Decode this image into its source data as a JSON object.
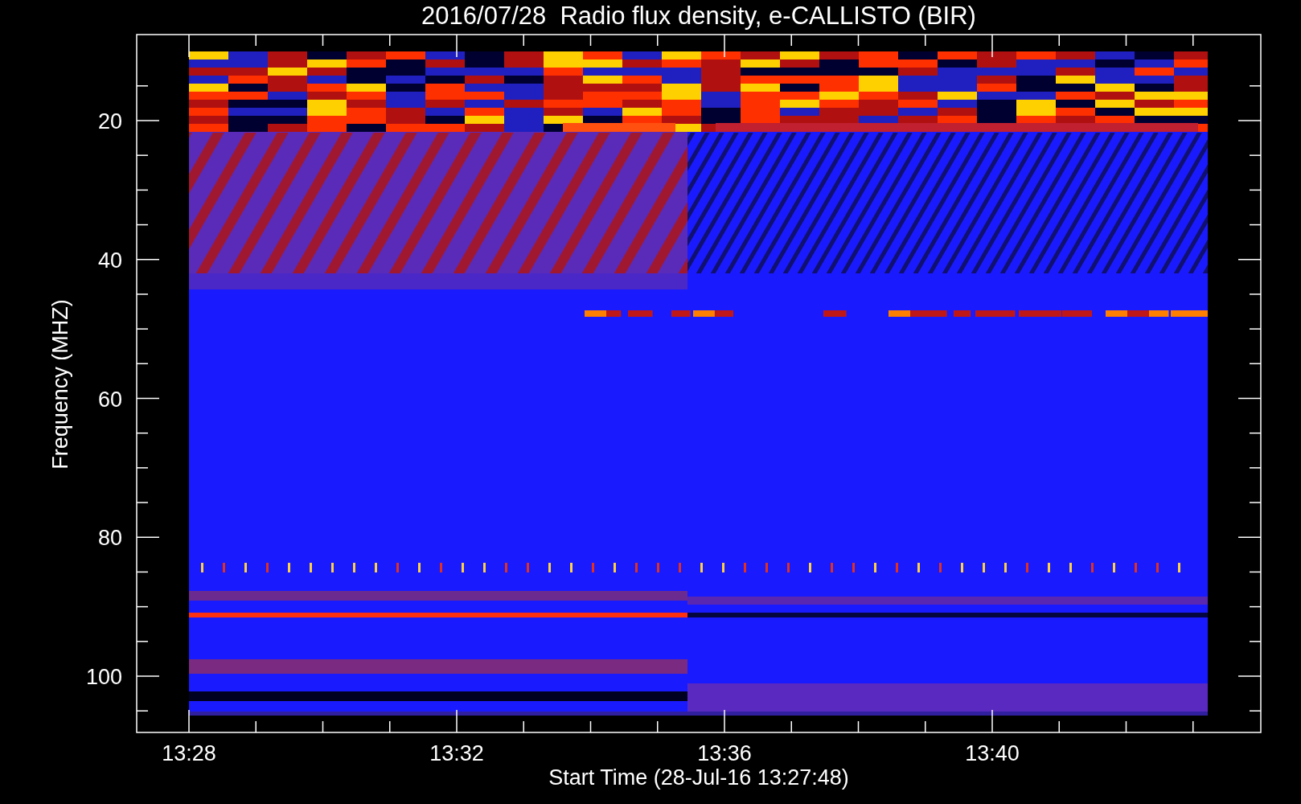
{
  "chart": {
    "title": "2016/07/28  Radio flux density, e-CALLISTO (BIR)",
    "ylabel": "Frequency (MHZ)",
    "yticks": [
      "20",
      "40",
      "60",
      "80",
      "100"
    ],
    "xlabel": "Start Time (28-Jul-16 13:27:48)",
    "xticks": [
      "13:28",
      "13:32",
      "13:36",
      "13:40"
    ]
  }
}
